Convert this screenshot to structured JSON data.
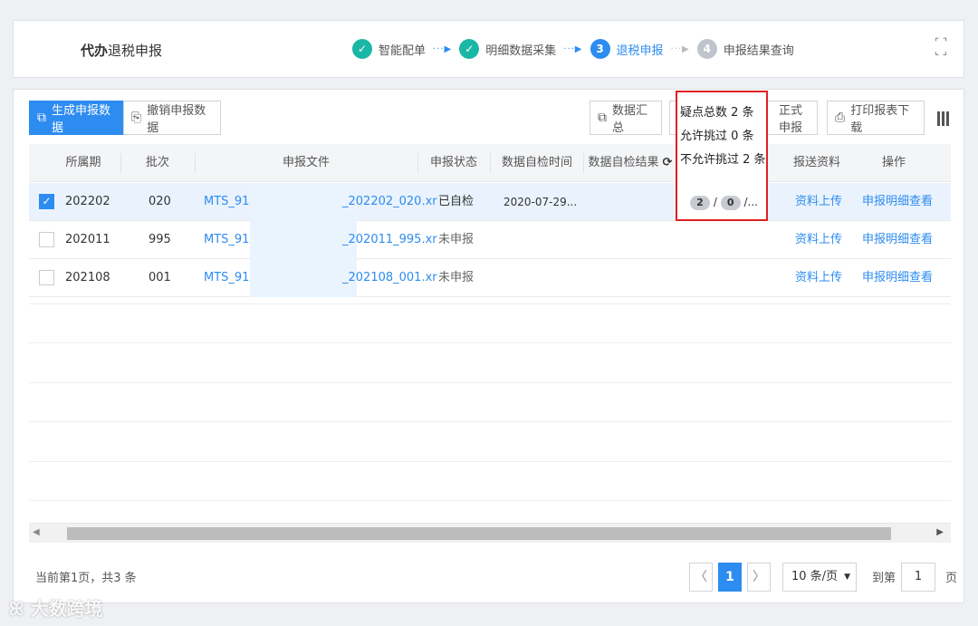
{
  "header": {
    "title_bold": "代办",
    "title_rest": "退税申报",
    "steps": [
      {
        "num": "✓",
        "label": "智能配单",
        "state": "done"
      },
      {
        "num": "✓",
        "label": "明细数据采集",
        "state": "done"
      },
      {
        "num": "3",
        "label": "退税申报",
        "state": "active"
      },
      {
        "num": "4",
        "label": "申报结果查询",
        "state": "todo"
      }
    ]
  },
  "toolbar": {
    "generate": "生成申报数据",
    "revoke": "撤销申报数据",
    "summary": "数据汇总",
    "formal": "正式申报",
    "print": "打印报表下载"
  },
  "table": {
    "headers": {
      "period": "所属期",
      "batch": "批次",
      "file": "申报文件",
      "status": "申报状态",
      "check_time": "数据自检时间",
      "check_result": "数据自检结果",
      "send": "报送资料",
      "ops": "操作"
    },
    "rows": [
      {
        "period": "202202",
        "batch": "020",
        "file_prefix": "MTS_914",
        "file_suffix": "_202202_020.xr",
        "status": "已自检",
        "check_time": "2020-07-29...",
        "pill_a": "2",
        "pill_b": "0",
        "send": "资料上传",
        "op": "申报明细查看",
        "checked": true
      },
      {
        "period": "202011",
        "batch": "995",
        "file_prefix": "MTS_914",
        "file_suffix": "_202011_995.xr",
        "status": "未申报",
        "check_time": "",
        "send": "资料上传",
        "op": "申报明细查看",
        "checked": false
      },
      {
        "period": "202108",
        "batch": "001",
        "file_prefix": "MTS_914",
        "file_suffix": "_202108_001.xr",
        "status": "未申报",
        "check_time": "",
        "send": "资料上传",
        "op": "申报明细查看",
        "checked": false
      }
    ]
  },
  "tooltip": {
    "total": "疑点总数 2 条",
    "allowed": "允许挑过 0 条",
    "not_allowed": "不允许挑过 2 条"
  },
  "pager": {
    "info": "当前第1页，共3 条",
    "current": "1",
    "prev": "〈",
    "next": "〉",
    "page_size": "10 条/页",
    "goto_label": "到第",
    "goto_value": "1",
    "goto_suffix": "页"
  },
  "watermark": "大数跨境"
}
